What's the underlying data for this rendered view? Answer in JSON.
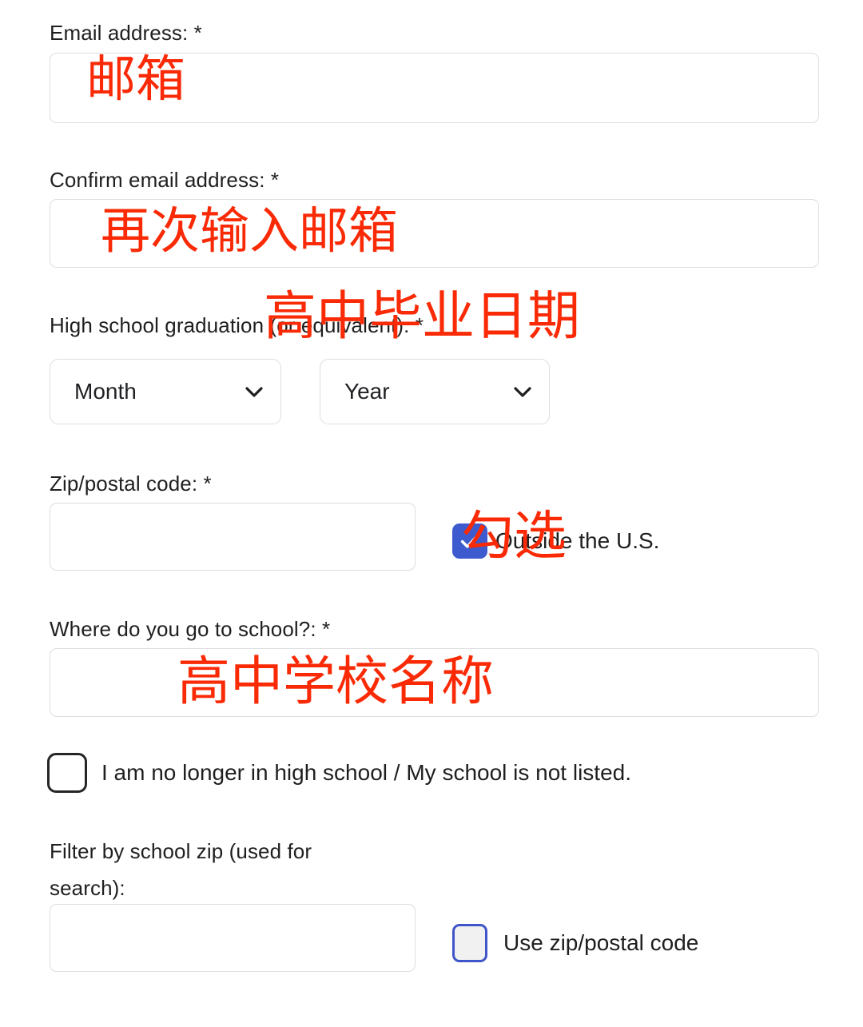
{
  "form": {
    "fields": [
      {
        "id": "email",
        "label": "Email address: *",
        "value": "",
        "placeholder": ""
      },
      {
        "id": "confirm_email",
        "label": "Confirm email address: *",
        "value": "",
        "placeholder": ""
      },
      {
        "id": "graduation",
        "label": "High school graduation (or equivalent): *",
        "month_select": "Month",
        "year_select": "Year"
      },
      {
        "id": "zip",
        "label": "Zip/postal code: *",
        "value": "",
        "placeholder": ""
      },
      {
        "id": "school",
        "label": "Where do you go to school?: *",
        "value": "",
        "placeholder": ""
      },
      {
        "id": "filter_zip",
        "label": "Filter by school zip (used for search):",
        "value": "",
        "placeholder": ""
      }
    ],
    "checkboxes": [
      {
        "id": "outside_us",
        "label": "Outside the U.S.",
        "checked": "true",
        "state": "checked-blue"
      },
      {
        "id": "not_in_high_school",
        "label": "I am no longer in high school / My school is not listed.",
        "checked": "false",
        "state": "unchecked-dark"
      },
      {
        "id": "use_zip_postal",
        "label": "Use zip/postal code",
        "checked": "false",
        "state": "unchecked-focused"
      }
    ]
  },
  "annotations": [
    {
      "id": "email-annot",
      "text": "邮箱"
    },
    {
      "id": "confirm-email-annot",
      "text": "再次输入邮箱"
    },
    {
      "id": "graduation-annot",
      "text": "高中毕业日期"
    },
    {
      "id": "checkbox-annot",
      "text": "勾选"
    },
    {
      "id": "school-annot",
      "text": "高中学校名称"
    }
  ],
  "colors": {
    "annotation_red": "#f92a05",
    "checkbox_blue": "#3d5bce",
    "focus_blue": "#4055c8",
    "input_border": "#dcdedf",
    "text": "#1f1f1f"
  }
}
